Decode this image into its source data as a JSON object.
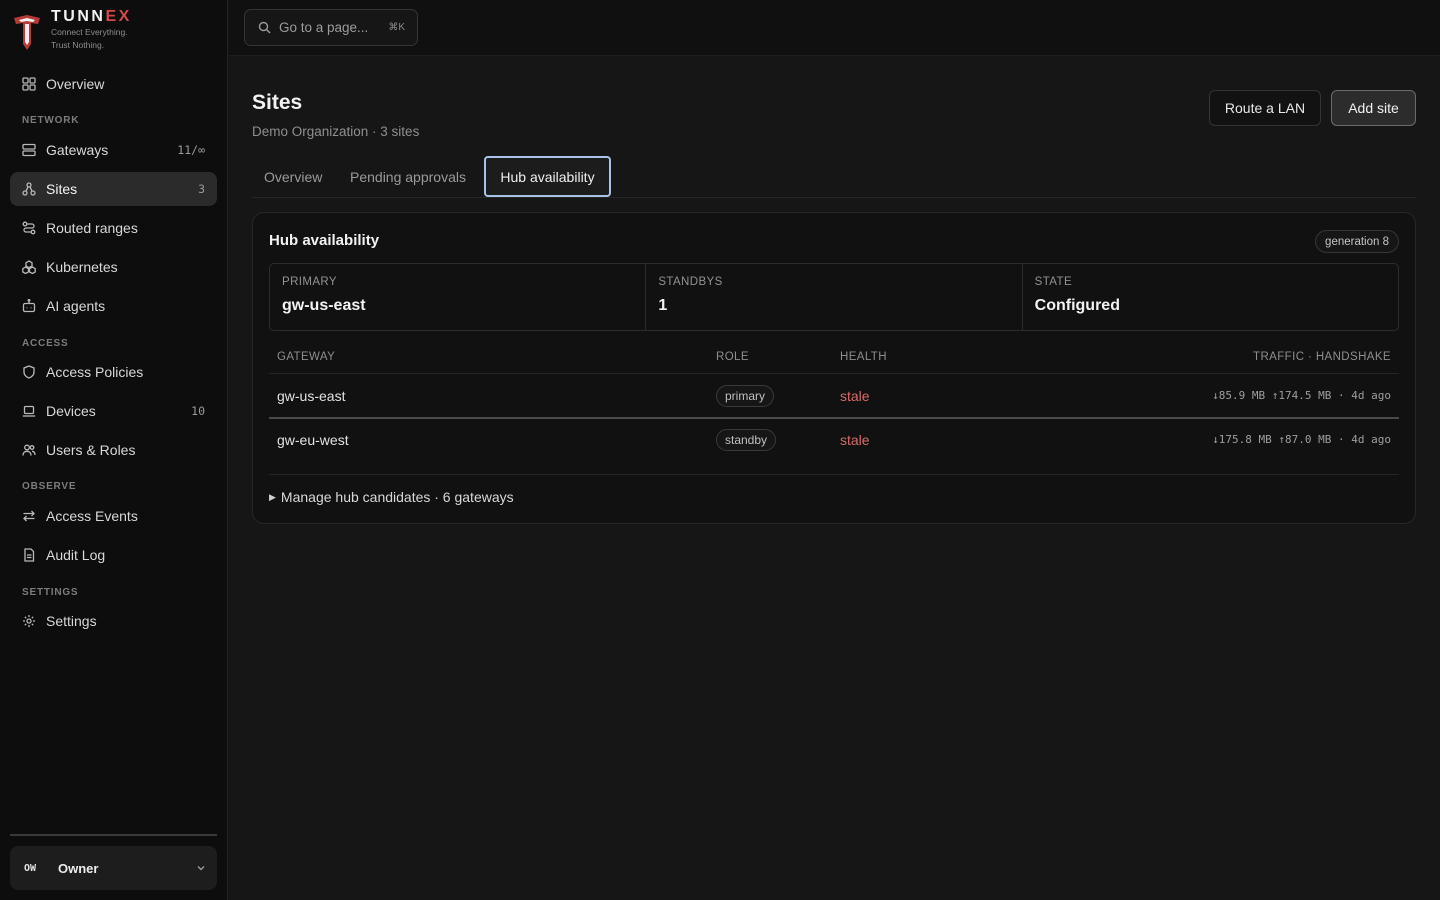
{
  "brand": {
    "name_prefix": "TUNN",
    "name_accent": "EX",
    "tagline_1": "Connect Everything.",
    "tagline_2": "Trust Nothing."
  },
  "sidebar": {
    "overview": "Overview",
    "sections": {
      "network": "NETWORK",
      "access": "ACCESS",
      "observe": "OBSERVE",
      "settings": "SETTINGS"
    },
    "items": {
      "gateways": {
        "label": "Gateways",
        "count": "11/∞"
      },
      "sites": {
        "label": "Sites",
        "count": "3"
      },
      "routed_ranges": {
        "label": "Routed ranges"
      },
      "kubernetes": {
        "label": "Kubernetes"
      },
      "ai_agents": {
        "label": "AI agents"
      },
      "access_policies": {
        "label": "Access Policies"
      },
      "devices": {
        "label": "Devices",
        "count": "10"
      },
      "users_roles": {
        "label": "Users & Roles"
      },
      "access_events": {
        "label": "Access Events"
      },
      "audit_log": {
        "label": "Audit Log"
      },
      "settings": {
        "label": "Settings"
      }
    },
    "user": {
      "initials": "OW",
      "name": "Owner"
    }
  },
  "topbar": {
    "search_placeholder": "Go to a page...",
    "search_shortcut": "⌘K"
  },
  "page": {
    "title": "Sites",
    "subtitle": "Demo Organization · 3 sites",
    "buttons": {
      "route_lan": "Route a LAN",
      "add_site": "Add site"
    },
    "tabs": {
      "overview": "Overview",
      "pending": "Pending approvals",
      "hub": "Hub availability"
    }
  },
  "hub": {
    "title": "Hub availability",
    "generation": "generation 8",
    "stats": {
      "primary_label": "PRIMARY",
      "primary_value": "gw-us-east",
      "standbys_label": "STANDBYS",
      "standbys_value": "1",
      "state_label": "STATE",
      "state_value": "Configured"
    },
    "table": {
      "headers": {
        "gateway": "GATEWAY",
        "role": "ROLE",
        "health": "HEALTH",
        "traffic": "TRAFFIC · HANDSHAKE"
      },
      "rows": [
        {
          "gateway": "gw-us-east",
          "role": "primary",
          "health": "stale",
          "traffic": "↓85.9 MB ↑174.5 MB · 4d ago"
        },
        {
          "gateway": "gw-eu-west",
          "role": "standby",
          "health": "stale",
          "traffic": "↓175.8 MB ↑87.0 MB · 4d ago"
        }
      ]
    },
    "manage": "Manage hub candidates · 6 gateways"
  },
  "colors": {
    "accent_red": "#d34a4a",
    "health_stale": "#d86a6a",
    "tab_focus_ring": "#a8c2ea"
  }
}
